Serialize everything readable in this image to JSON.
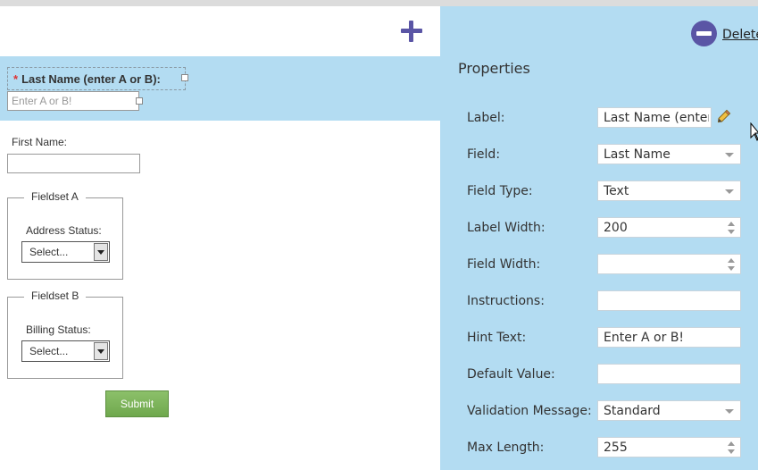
{
  "canvas": {
    "add_icon": "plus-icon",
    "last_name": {
      "required_mark": "*",
      "label": "Last Name (enter A or B):",
      "placeholder": "Enter A or B!"
    },
    "first_name": {
      "label": "First Name:"
    },
    "fieldset_a": {
      "legend": "Fieldset A",
      "label": "Address Status:",
      "select_value": "Select..."
    },
    "fieldset_b": {
      "legend": "Fieldset B",
      "label": "Billing Status:",
      "select_value": "Select..."
    },
    "submit_label": "Submit"
  },
  "panel": {
    "delete_icon": "minus-circle-icon",
    "delete_label": "Delete",
    "title": "Properties",
    "rows": [
      {
        "label": "Label:",
        "value": "Last Name (enter A or B):",
        "control": "text",
        "icon": "pencil-icon"
      },
      {
        "label": "Field:",
        "value": "Last Name",
        "control": "dropdown"
      },
      {
        "label": "Field Type:",
        "value": "Text",
        "control": "dropdown"
      },
      {
        "label": "Label Width:",
        "value": "200",
        "control": "spinner"
      },
      {
        "label": "Field Width:",
        "value": "",
        "control": "spinner"
      },
      {
        "label": "Instructions:",
        "value": "",
        "control": "text"
      },
      {
        "label": "Hint Text:",
        "value": "Enter A or B!",
        "control": "text"
      },
      {
        "label": "Default Value:",
        "value": "",
        "control": "text"
      },
      {
        "label": "Validation Message:",
        "value": "Standard",
        "control": "dropdown"
      },
      {
        "label": "Max Length:",
        "value": "255",
        "control": "spinner"
      }
    ]
  },
  "colors": {
    "panel_bg": "#b3dcf2",
    "accent": "#5a55a5",
    "submit_green": "#7ab55c",
    "required_red": "#dd3333"
  }
}
